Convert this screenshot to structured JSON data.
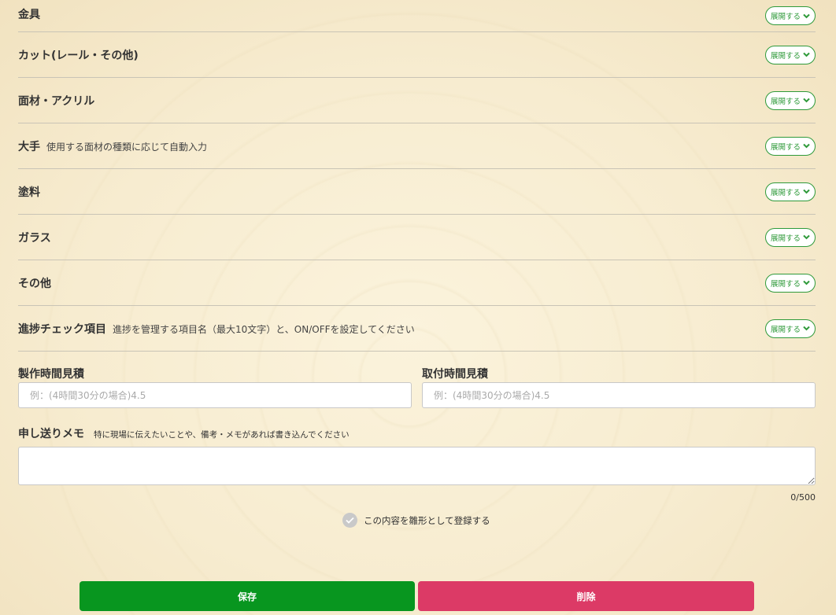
{
  "sections": [
    {
      "label": "金具",
      "note": "",
      "expand": "展開する"
    },
    {
      "label": "カット(レール・その他)",
      "note": "",
      "expand": "展開する"
    },
    {
      "label": "面材・アクリル",
      "note": "",
      "expand": "展開する"
    },
    {
      "label": "大手",
      "note": "使用する面材の種類に応じて自動入力",
      "expand": "展開する"
    },
    {
      "label": "塗料",
      "note": "",
      "expand": "展開する"
    },
    {
      "label": "ガラス",
      "note": "",
      "expand": "展開する"
    },
    {
      "label": "その他",
      "note": "",
      "expand": "展開する"
    },
    {
      "label": "進捗チェック項目",
      "note": "進捗を管理する項目名（最大10文字）と、ON/OFFを設定してください",
      "expand": "展開する"
    }
  ],
  "estimates": {
    "production": {
      "label": "製作時間見積",
      "placeholder": "例：(4時間30分の場合)4.5",
      "value": ""
    },
    "installation": {
      "label": "取付時間見積",
      "placeholder": "例：(4時間30分の場合)4.5",
      "value": ""
    }
  },
  "memo": {
    "label": "申し送りメモ",
    "note": "特に現場に伝えたいことや、備考・メモがあれば書き込んでください",
    "value": "",
    "counter": "0/500"
  },
  "template": {
    "label": "この内容を雛形として登録する",
    "checked": false
  },
  "actions": {
    "save": "保存",
    "delete": "削除"
  },
  "colors": {
    "accent_green": "#08961f",
    "danger": "#dc3a66",
    "expand_border": "#2f9a3a"
  }
}
